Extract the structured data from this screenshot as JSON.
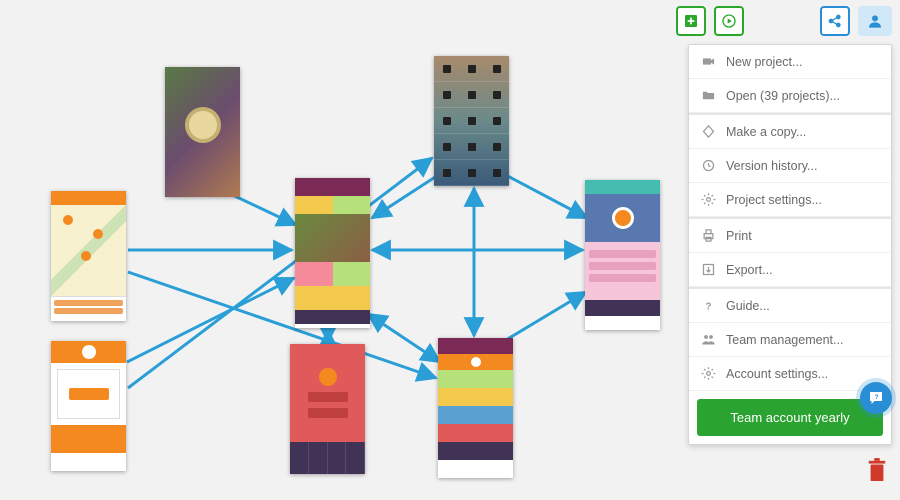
{
  "toolbar": {
    "add_icon": "plus-square-icon",
    "play_icon": "play-icon",
    "share_icon": "share-icon",
    "user_icon": "user-icon"
  },
  "menu": {
    "new_project": "New project...",
    "open": "Open (39 projects)...",
    "make_copy": "Make a copy...",
    "version_history": "Version history...",
    "project_settings": "Project settings...",
    "print": "Print",
    "export": "Export...",
    "guide": "Guide...",
    "team_mgmt": "Team management...",
    "account_settings": "Account settings...",
    "cta": "Team account yearly"
  },
  "help_bubble": "?",
  "screens": {
    "s1": "welcome-badge-screen",
    "s2": "map-screen",
    "s3": "list-orange-screen",
    "s4": "hub-screen",
    "s5": "red-actions-screen",
    "s6": "media-player-screen",
    "s7": "colorful-list-screen",
    "s8": "profile-screen"
  },
  "colors": {
    "green": "#2ba82b",
    "blue": "#2a8ed6",
    "cta_green": "#2aa330",
    "trash_red": "#d03a2a",
    "arrow": "#2a9ed6"
  },
  "arrows": [
    {
      "from": "s1",
      "to": "s4"
    },
    {
      "from": "s2",
      "to": "s4"
    },
    {
      "from": "s3",
      "to": "s4"
    },
    {
      "from": "s5",
      "to": "s4",
      "bidir": true
    },
    {
      "from": "s6",
      "to": "s4"
    },
    {
      "from": "s4",
      "to": "s8",
      "bidir": true
    },
    {
      "from": "s6",
      "to": "s8"
    },
    {
      "from": "s7",
      "to": "s8"
    },
    {
      "from": "s7",
      "to": "s6",
      "bidir": true
    },
    {
      "from": "s2",
      "to": "s7"
    },
    {
      "from": "s3",
      "to": "s6"
    },
    {
      "from": "s4",
      "to": "s7",
      "bidir": true
    }
  ]
}
